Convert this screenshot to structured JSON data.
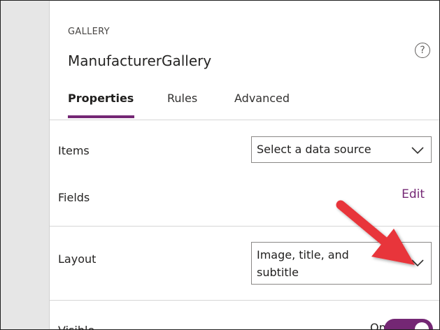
{
  "header": {
    "control_type": "GALLERY",
    "control_name": "ManufacturerGallery",
    "help_icon": "help-circle-icon",
    "help_glyph": "?"
  },
  "tabs": [
    {
      "label": "Properties",
      "active": true
    },
    {
      "label": "Rules",
      "active": false
    },
    {
      "label": "Advanced",
      "active": false
    }
  ],
  "properties": {
    "items": {
      "label": "Items",
      "value": "Select a data source"
    },
    "fields": {
      "label": "Fields",
      "action": "Edit"
    },
    "layout": {
      "label": "Layout",
      "value_line1": "Image, title, and",
      "value_line2": "subtitle"
    },
    "visible": {
      "label": "Visible",
      "state": "On"
    }
  },
  "colors": {
    "accent": "#742774",
    "annotation_arrow": "#e8343a"
  }
}
